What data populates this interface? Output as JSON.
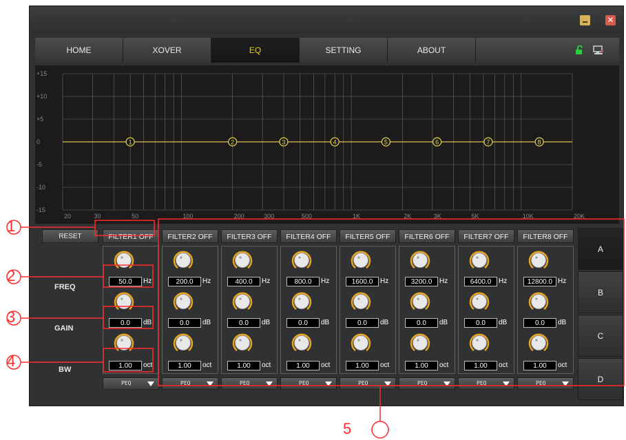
{
  "window": {
    "minimize_icon": "minimize-icon",
    "close_glyph": "✕"
  },
  "nav": {
    "tabs": [
      {
        "label": "HOME",
        "active": false
      },
      {
        "label": "XOVER",
        "active": false
      },
      {
        "label": "EQ",
        "active": true
      },
      {
        "label": "SETTING",
        "active": false
      },
      {
        "label": "ABOUT",
        "active": false
      }
    ],
    "icons": [
      "unlock-icon",
      "network-icon"
    ]
  },
  "graph": {
    "y_ticks": [
      "+15",
      "+10",
      "+5",
      "0",
      "-5",
      "-10",
      "-15"
    ],
    "x_ticks": [
      "20",
      "30",
      "50",
      "100",
      "200",
      "300",
      "500",
      "1K",
      "2K",
      "3K",
      "5K",
      "10K",
      "20K"
    ],
    "markers": [
      "1",
      "2",
      "3",
      "4",
      "5",
      "6",
      "7",
      "8"
    ],
    "line_color": "#e0c050"
  },
  "controls": {
    "reset_label": "RESET",
    "row_labels": {
      "freq": "FREQ",
      "gain": "GAIN",
      "bw": "BW"
    },
    "units": {
      "freq": "Hz",
      "gain": "dB",
      "bw": "oct"
    },
    "filters": [
      {
        "label": "FILTER1 OFF",
        "freq": "50.0",
        "gain": "0.0",
        "bw": "1.00",
        "type": "PEQ"
      },
      {
        "label": "FILTER2 OFF",
        "freq": "200.0",
        "gain": "0.0",
        "bw": "1.00",
        "type": "PEQ"
      },
      {
        "label": "FILTER3 OFF",
        "freq": "400.0",
        "gain": "0.0",
        "bw": "1.00",
        "type": "PEQ"
      },
      {
        "label": "FILTER4 OFF",
        "freq": "800.0",
        "gain": "0.0",
        "bw": "1.00",
        "type": "PEQ"
      },
      {
        "label": "FILTER5 OFF",
        "freq": "1600.0",
        "gain": "0.0",
        "bw": "1.00",
        "type": "PEQ"
      },
      {
        "label": "FILTER6 OFF",
        "freq": "3200.0",
        "gain": "0.0",
        "bw": "1.00",
        "type": "PEQ"
      },
      {
        "label": "FILTER7 OFF",
        "freq": "6400.0",
        "gain": "0.0",
        "bw": "1.00",
        "type": "PEQ"
      },
      {
        "label": "FILTER8 OFF",
        "freq": "12800.0",
        "gain": "0.0",
        "bw": "1.00",
        "type": "PEQ"
      }
    ],
    "presets": [
      {
        "label": "A",
        "active": true
      },
      {
        "label": "B",
        "active": false
      },
      {
        "label": "C",
        "active": false
      },
      {
        "label": "D",
        "active": false
      }
    ],
    "knob_accent": "#e8a623"
  },
  "annotations": {
    "labels": [
      "1",
      "2",
      "3",
      "4",
      "5"
    ],
    "color": "#ff2a2a"
  }
}
